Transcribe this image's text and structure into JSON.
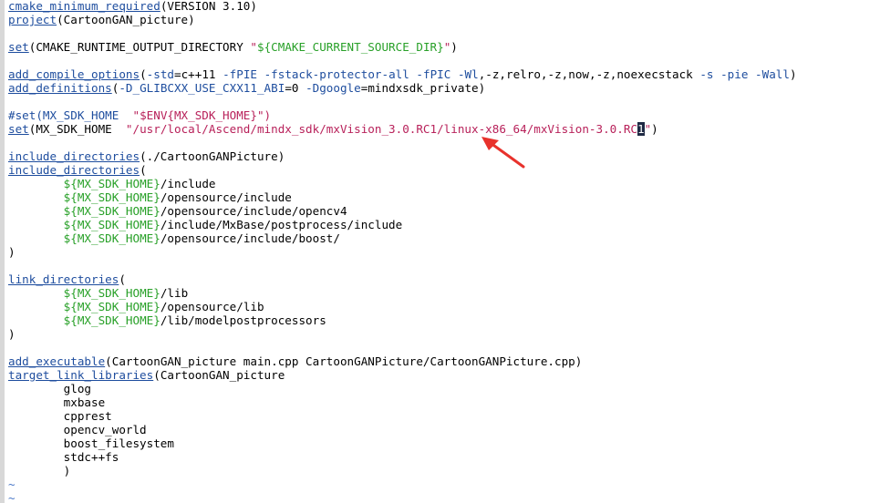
{
  "editor": {
    "lines": [
      {
        "segments": [
          {
            "t": "k",
            "x": "cmake_minimum_required"
          },
          {
            "t": "p",
            "x": "(VERSION 3.10)"
          }
        ]
      },
      {
        "segments": [
          {
            "t": "k",
            "x": "project"
          },
          {
            "t": "p",
            "x": "(CartoonGAN_picture)"
          }
        ]
      },
      {
        "segments": []
      },
      {
        "segments": [
          {
            "t": "k",
            "x": "set"
          },
          {
            "t": "p",
            "x": "(CMAKE_RUNTIME_OUTPUT_DIRECTORY "
          },
          {
            "t": "s",
            "x": "\""
          },
          {
            "t": "v",
            "x": "${CMAKE_CURRENT_SOURCE_DIR}"
          },
          {
            "t": "s",
            "x": "\""
          },
          {
            "t": "p",
            "x": ")"
          }
        ]
      },
      {
        "segments": []
      },
      {
        "segments": [
          {
            "t": "k",
            "x": "add_compile_options"
          },
          {
            "t": "p",
            "x": "("
          },
          {
            "t": "o",
            "x": "-std"
          },
          {
            "t": "p",
            "x": "=c++11 "
          },
          {
            "t": "o",
            "x": "-fPIE"
          },
          {
            "t": "p",
            "x": " "
          },
          {
            "t": "o",
            "x": "-fstack-protector-all"
          },
          {
            "t": "p",
            "x": " "
          },
          {
            "t": "o",
            "x": "-fPIC"
          },
          {
            "t": "p",
            "x": " "
          },
          {
            "t": "o",
            "x": "-Wl"
          },
          {
            "t": "p",
            "x": ",-z,relro,-z,now,-z,noexecstack "
          },
          {
            "t": "o",
            "x": "-s"
          },
          {
            "t": "p",
            "x": " "
          },
          {
            "t": "o",
            "x": "-pie"
          },
          {
            "t": "p",
            "x": " "
          },
          {
            "t": "o",
            "x": "-Wall"
          },
          {
            "t": "p",
            "x": ")"
          }
        ]
      },
      {
        "segments": [
          {
            "t": "k",
            "x": "add_definitions"
          },
          {
            "t": "p",
            "x": "("
          },
          {
            "t": "o",
            "x": "-D_GLIBCXX_USE_CXX11_ABI"
          },
          {
            "t": "p",
            "x": "=0 "
          },
          {
            "t": "o",
            "x": "-Dgoogle"
          },
          {
            "t": "p",
            "x": "=mindxsdk_private)"
          }
        ]
      },
      {
        "segments": []
      },
      {
        "segments": [
          {
            "t": "c",
            "x": "#set(MX_SDK_HOME  "
          },
          {
            "t": "s",
            "x": "\"$ENV{MX_SDK_HOME}\")"
          }
        ]
      },
      {
        "segments": [
          {
            "t": "k",
            "x": "set"
          },
          {
            "t": "p",
            "x": "(MX_SDK_HOME  "
          },
          {
            "t": "s",
            "x": "\"/usr/local/Ascend/mindx_sdk/mxVision_3.0.RC1/linux-x86_64/mxVision-3.0.RC"
          },
          {
            "t": "cursor",
            "x": "1"
          },
          {
            "t": "s",
            "x": "\""
          },
          {
            "t": "p",
            "x": ")"
          }
        ]
      },
      {
        "segments": []
      },
      {
        "segments": [
          {
            "t": "k",
            "x": "include_directories"
          },
          {
            "t": "p",
            "x": "(./CartoonGANPicture)"
          }
        ]
      },
      {
        "segments": [
          {
            "t": "k",
            "x": "include_directories"
          },
          {
            "t": "p",
            "x": "("
          }
        ]
      },
      {
        "segments": [
          {
            "t": "p",
            "x": "        "
          },
          {
            "t": "v",
            "x": "${MX_SDK_HOME}"
          },
          {
            "t": "p",
            "x": "/include"
          }
        ]
      },
      {
        "segments": [
          {
            "t": "p",
            "x": "        "
          },
          {
            "t": "v",
            "x": "${MX_SDK_HOME}"
          },
          {
            "t": "p",
            "x": "/opensource/include"
          }
        ]
      },
      {
        "segments": [
          {
            "t": "p",
            "x": "        "
          },
          {
            "t": "v",
            "x": "${MX_SDK_HOME}"
          },
          {
            "t": "p",
            "x": "/opensource/include/opencv4"
          }
        ]
      },
      {
        "segments": [
          {
            "t": "p",
            "x": "        "
          },
          {
            "t": "v",
            "x": "${MX_SDK_HOME}"
          },
          {
            "t": "p",
            "x": "/include/MxBase/postprocess/include"
          }
        ]
      },
      {
        "segments": [
          {
            "t": "p",
            "x": "        "
          },
          {
            "t": "v",
            "x": "${MX_SDK_HOME}"
          },
          {
            "t": "p",
            "x": "/opensource/include/boost/"
          }
        ]
      },
      {
        "segments": [
          {
            "t": "p",
            "x": ")"
          }
        ]
      },
      {
        "segments": []
      },
      {
        "segments": [
          {
            "t": "k",
            "x": "link_directories"
          },
          {
            "t": "p",
            "x": "("
          }
        ]
      },
      {
        "segments": [
          {
            "t": "p",
            "x": "        "
          },
          {
            "t": "v",
            "x": "${MX_SDK_HOME}"
          },
          {
            "t": "p",
            "x": "/lib"
          }
        ]
      },
      {
        "segments": [
          {
            "t": "p",
            "x": "        "
          },
          {
            "t": "v",
            "x": "${MX_SDK_HOME}"
          },
          {
            "t": "p",
            "x": "/opensource/lib"
          }
        ]
      },
      {
        "segments": [
          {
            "t": "p",
            "x": "        "
          },
          {
            "t": "v",
            "x": "${MX_SDK_HOME}"
          },
          {
            "t": "p",
            "x": "/lib/modelpostprocessors"
          }
        ]
      },
      {
        "segments": [
          {
            "t": "p",
            "x": ")"
          }
        ]
      },
      {
        "segments": []
      },
      {
        "segments": [
          {
            "t": "k",
            "x": "add_executable"
          },
          {
            "t": "p",
            "x": "(CartoonGAN_picture main.cpp CartoonGANPicture/CartoonGANPicture.cpp)"
          }
        ]
      },
      {
        "segments": [
          {
            "t": "k",
            "x": "target_link_libraries"
          },
          {
            "t": "p",
            "x": "(CartoonGAN_picture"
          }
        ]
      },
      {
        "segments": [
          {
            "t": "p",
            "x": "        glog"
          }
        ]
      },
      {
        "segments": [
          {
            "t": "p",
            "x": "        mxbase"
          }
        ]
      },
      {
        "segments": [
          {
            "t": "p",
            "x": "        cpprest"
          }
        ]
      },
      {
        "segments": [
          {
            "t": "p",
            "x": "        opencv_world"
          }
        ]
      },
      {
        "segments": [
          {
            "t": "p",
            "x": "        boost_filesystem"
          }
        ]
      },
      {
        "segments": [
          {
            "t": "p",
            "x": "        stdc++fs"
          }
        ]
      },
      {
        "segments": [
          {
            "t": "p",
            "x": "        )"
          }
        ]
      },
      {
        "segments": [
          {
            "t": "tilde",
            "x": "~"
          }
        ]
      },
      {
        "segments": [
          {
            "t": "tilde",
            "x": "~"
          }
        ]
      }
    ]
  },
  "annotation": {
    "arrow_color": "#e8322c"
  }
}
